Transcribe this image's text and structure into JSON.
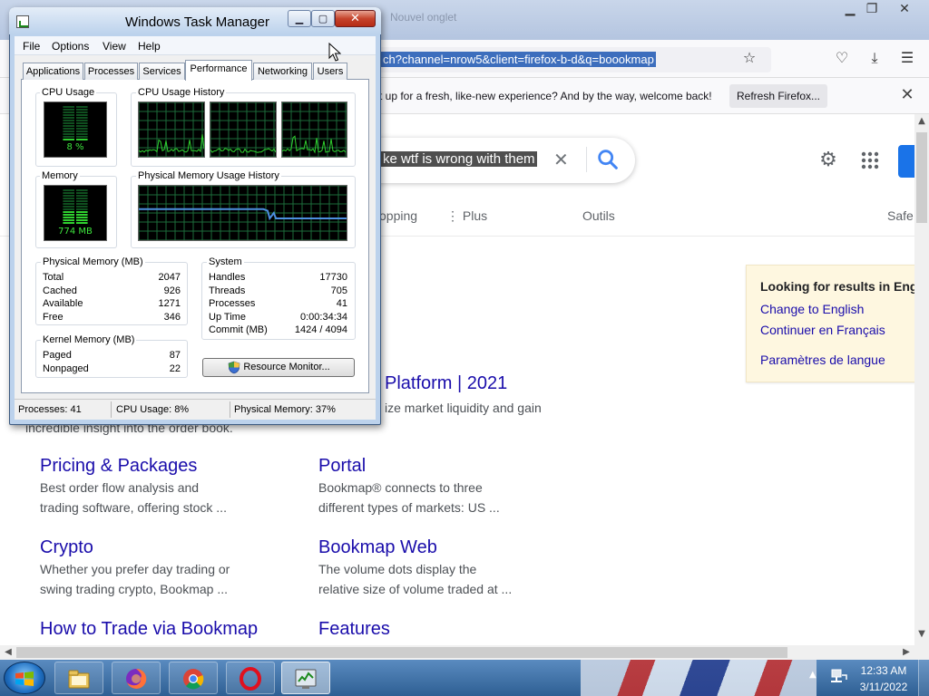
{
  "colors": {
    "tm_graph_green": "#2fd12f",
    "tm_grid": "#1d6b3a",
    "tm_memory_line": "#4d8fe0",
    "google_link": "#1a0dab",
    "google_text": "#4d5156",
    "taskbar": "#2e5f93"
  },
  "firefox": {
    "tab_ghost": "Nouvel onglet",
    "url_selected": "ch?channel=nrow5&client=firefox-b-d&q=boookmap",
    "notice_text": "t up for a fresh, like-new experience? And by the way, welcome back!",
    "refresh_button": "Refresh Firefox...",
    "icons": [
      "star-icon",
      "pocket-icon",
      "download-icon",
      "menu-icon"
    ]
  },
  "google": {
    "query_selected": "ke wtf is wrong with them",
    "nav_tabs": [
      "opping",
      "⋮ Plus",
      "Outils",
      "Safe"
    ],
    "lang_box": {
      "title": "Looking for results in Engli",
      "links": [
        "Change to English",
        "Continuer en Français",
        "Paramètres de langue"
      ]
    },
    "top_result": {
      "title": "Platform | 2021",
      "desc_line1": "ize market liquidity and gain",
      "desc_line2": "incredible insight into the order book."
    },
    "results": [
      {
        "title": "Pricing & Packages",
        "line1": "Best order flow analysis and",
        "line2": "trading software, offering stock ..."
      },
      {
        "title": "Portal",
        "line1": "Bookmap® connects to three",
        "line2": "different types of markets: US ..."
      },
      {
        "title": "Crypto",
        "line1": "Whether you prefer day trading or",
        "line2": "swing trading crypto, Bookmap ..."
      },
      {
        "title": "Bookmap Web",
        "line1": "The volume dots display the",
        "line2": "relative size of volume traded at ..."
      },
      {
        "title": "How to Trade via Bookmap",
        "line1": "",
        "line2": ""
      },
      {
        "title": "Features",
        "line1": "",
        "line2": ""
      }
    ]
  },
  "task_manager": {
    "title": "Windows Task Manager",
    "menu": [
      "File",
      "Options",
      "View",
      "Help"
    ],
    "tabs": [
      "Applications",
      "Processes",
      "Services",
      "Performance",
      "Networking",
      "Users"
    ],
    "active_tab": "Performance",
    "cpu_usage_label": "CPU Usage",
    "cpu_usage_value": "8 %",
    "cpu_usage_fraction": 0.08,
    "cpu_history_label": "CPU Usage History",
    "memory_label": "Memory",
    "memory_value": "774 MB",
    "memory_fraction": 0.37,
    "memory_history_label": "Physical Memory Usage History",
    "physical_memory": {
      "label": "Physical Memory (MB)",
      "rows": [
        {
          "name": "Total",
          "value": "2047"
        },
        {
          "name": "Cached",
          "value": "926"
        },
        {
          "name": "Available",
          "value": "1271"
        },
        {
          "name": "Free",
          "value": "346"
        }
      ]
    },
    "system": {
      "label": "System",
      "rows": [
        {
          "name": "Handles",
          "value": "17730"
        },
        {
          "name": "Threads",
          "value": "705"
        },
        {
          "name": "Processes",
          "value": "41"
        },
        {
          "name": "Up Time",
          "value": "0:00:34:34"
        },
        {
          "name": "Commit (MB)",
          "value": "1424 / 4094"
        }
      ]
    },
    "kernel_memory": {
      "label": "Kernel Memory (MB)",
      "rows": [
        {
          "name": "Paged",
          "value": "87"
        },
        {
          "name": "Nonpaged",
          "value": "22"
        }
      ]
    },
    "resource_monitor_button": "Resource Monitor...",
    "status": {
      "processes": "Processes: 41",
      "cpu": "CPU Usage: 8%",
      "memory": "Physical Memory: 37%"
    }
  },
  "taskbar": {
    "time": "12:33 AM",
    "date": "3/11/2022",
    "items": [
      "windows-explorer",
      "firefox",
      "chrome",
      "opera",
      "task-manager"
    ]
  }
}
